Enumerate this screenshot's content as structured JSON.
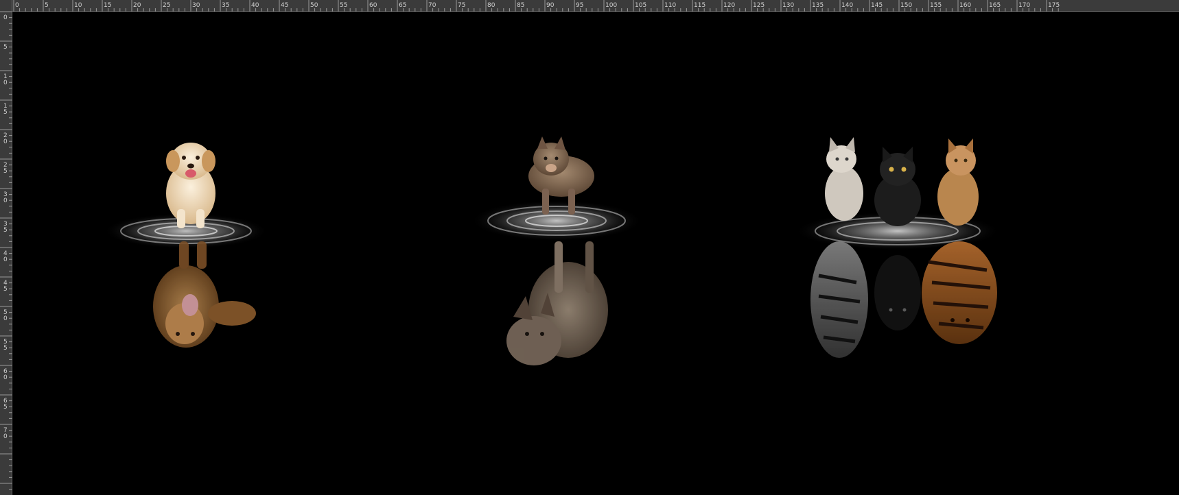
{
  "app": {
    "title": ""
  },
  "rulers": {
    "horizontal_labels": [
      "0",
      "5",
      "10",
      "15",
      "20",
      "25",
      "30",
      "35",
      "40",
      "45",
      "50",
      "55",
      "60",
      "65",
      "70",
      "75",
      "80",
      "85",
      "90",
      "95",
      "100",
      "105",
      "110",
      "115",
      "120",
      "125",
      "130",
      "135",
      "140",
      "145",
      "150",
      "155",
      "160",
      "165",
      "170",
      "175"
    ],
    "vertical_labels": [
      "0",
      "5",
      "10",
      "15",
      "20",
      "25",
      "30",
      "35",
      "40",
      "45",
      "50",
      "55",
      "60",
      "65",
      "70"
    ]
  },
  "canvas": {
    "background": "#000000",
    "scenes": [
      {
        "subject": "golden-retriever-puppy",
        "reflection": "lion",
        "subject_color": "#e8d2b2",
        "reflection_color": "#9a6a3a"
      },
      {
        "subject": "wolf-pup",
        "reflection": "grey-wolf",
        "subject_color": "#8a6f58",
        "reflection_color": "#7a6a5c"
      },
      {
        "subject": "three-kittens",
        "reflection": "white-tiger-panther-tiger",
        "subject_color": "#c9c2b8",
        "reflection_color": "#b06a2a"
      }
    ]
  },
  "colors": {
    "ruler_bg": "#3b3b3b",
    "ruler_text": "#d0d0d0",
    "ruler_tick": "#9a9a9a"
  }
}
